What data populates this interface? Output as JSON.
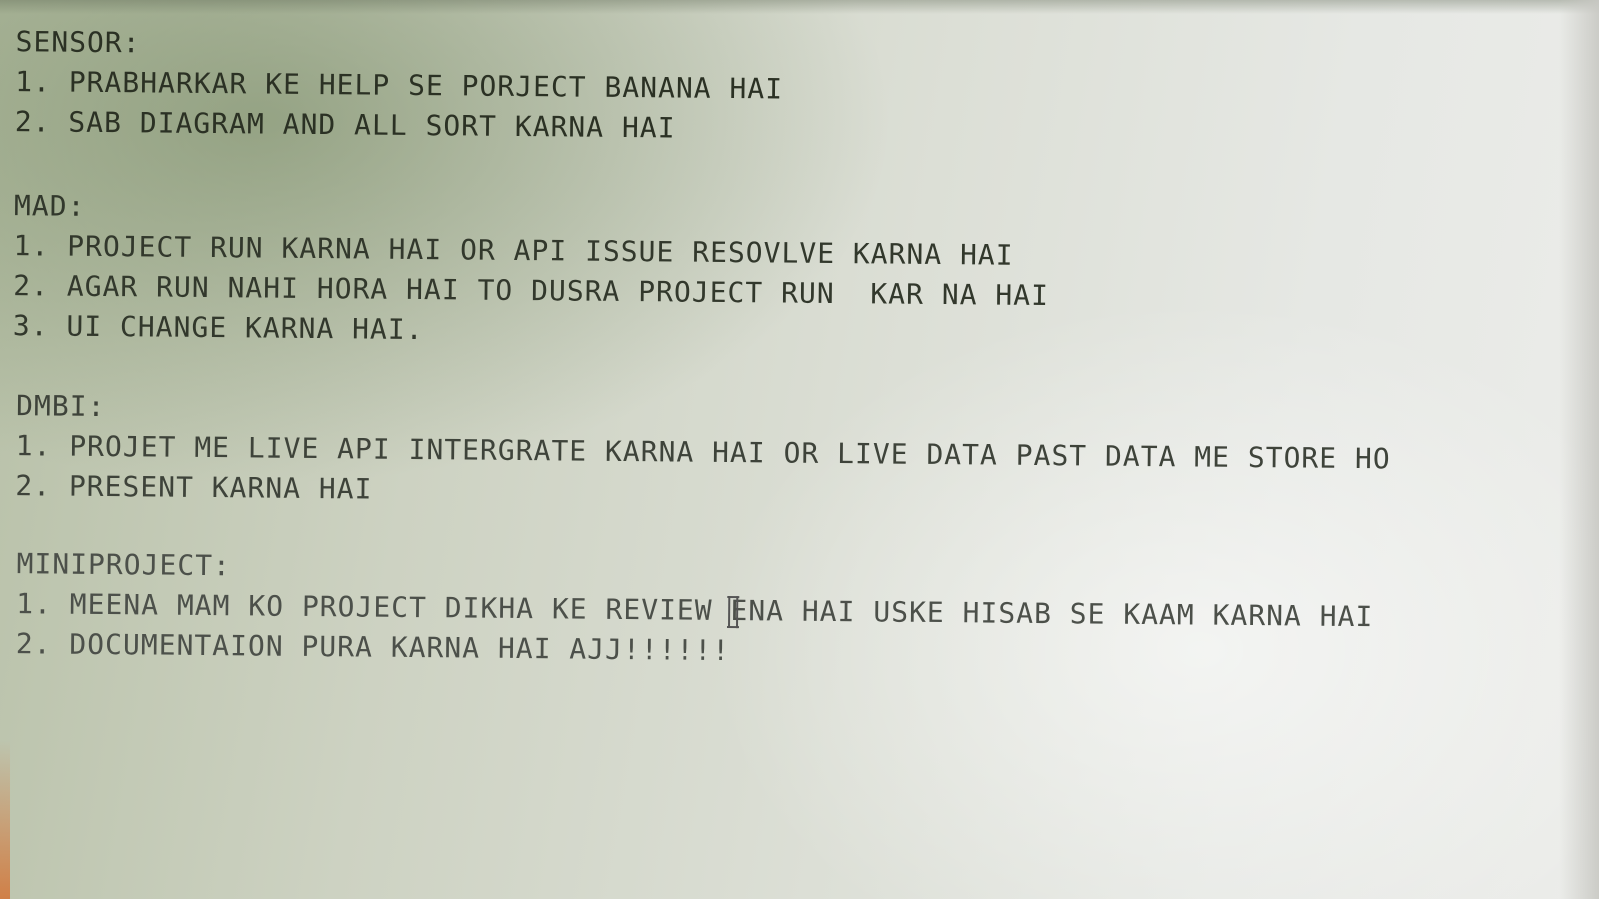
{
  "sections": [
    {
      "heading": "SENSOR:",
      "items": [
        "1. PRABHARKAR KE HELP SE PORJECT BANANA HAI",
        "2. SAB DIAGRAM AND ALL SORT KARNA HAI"
      ]
    },
    {
      "heading": "MAD:",
      "items": [
        "1. PROJECT RUN KARNA HAI OR API ISSUE RESOVLVE KARNA HAI",
        "2. AGAR RUN NAHI HORA HAI TO DUSRA PROJECT RUN  KAR NA HAI",
        "3. UI CHANGE KARNA HAI."
      ]
    },
    {
      "heading": "DMBI:",
      "items": [
        "1. PROJET ME LIVE API INTERGRATE KARNA HAI OR LIVE DATA PAST DATA ME STORE HO",
        "2. PRESENT KARNA HAI"
      ]
    },
    {
      "heading": "MINIPROJECT:",
      "items": [
        {
          "before_cursor": "1. MEENA MAM KO PROJECT DIKHA KE REVIEW ",
          "after_cursor": "ENA HAI USKE HISAB SE KAAM KARNA HAI"
        },
        "2. DOCUMENTAION PURA KARNA HAI AJJ!!!!!!"
      ]
    }
  ],
  "icons": {
    "text_cursor": "i-beam-cursor-icon"
  }
}
